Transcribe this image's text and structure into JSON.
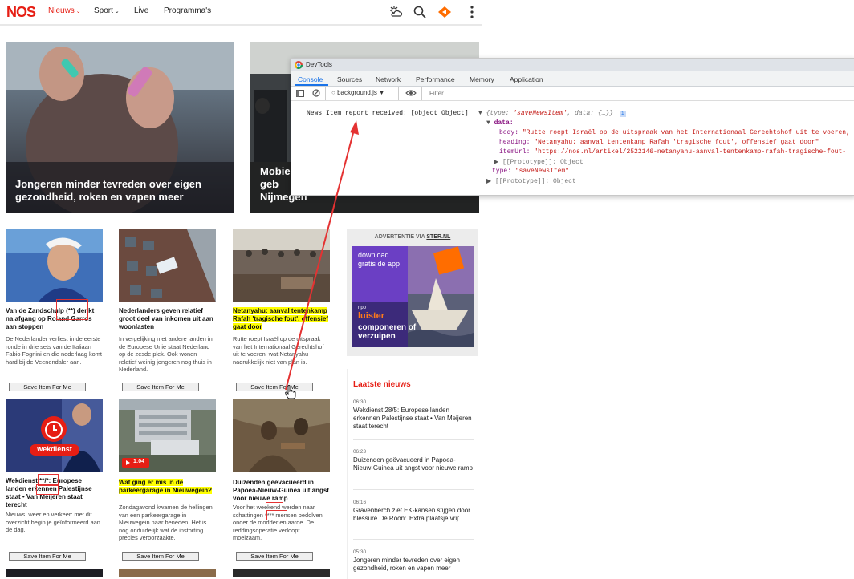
{
  "nav": {
    "logo": "NOS",
    "items": [
      {
        "label": "Nieuws",
        "caret": "⌄",
        "active": true
      },
      {
        "label": "Sport",
        "caret": "⌄",
        "active": false
      },
      {
        "label": "Live",
        "caret": "",
        "active": false
      },
      {
        "label": "Programma's",
        "caret": "",
        "active": false
      }
    ]
  },
  "hero": [
    {
      "caption": "Jongeren minder tevreden over eigen gezondheid, roken en vapen meer"
    },
    {
      "caption": "Mobie in geb Nijmegen"
    }
  ],
  "cards": [
    {
      "title": "Van de Zandschulp (**) denkt na afgang op Roland Garros aan stoppen",
      "body": "De Nederlander verliest in de eerste ronde in drie sets van de Italiaan Fabio Fognini en die nederlaag komt hard bij de Veenendaler aan.",
      "button": "Save Item For Me",
      "highlight": false
    },
    {
      "title": "Nederlanders geven relatief groot deel van inkomen uit aan woonlasten",
      "body": "In vergelijking met andere landen in de Europese Unie staat Nederland op de zesde plek. Ook wonen relatief weinig jongeren nog thuis in Nederland.",
      "button": "Save Item For Me",
      "highlight": false
    },
    {
      "title": "Netanyahu: aanval tentenkamp Rafah 'tragische fout', offensief gaat door",
      "body": "Rutte roept Israël op de uitspraak van het Internationaal Gerechtshof uit te voeren, wat Netanyahu nadrukkelijk niet van plan is.",
      "button": "Save Item For Me",
      "highlight": true
    },
    {
      "title": "Wekdienst **/*: Europese landen erkennen Palestijnse staat • Van Meijeren staat terecht",
      "body": "Nieuws, weer en verkeer: met dit overzicht begin je geïnformeerd aan de dag.",
      "button": "Save Item For Me",
      "highlight": false,
      "badge": "wekdienst"
    },
    {
      "title": "Wat ging er mis in de parkeergarage in Nieuwegein?",
      "body": "Zondagavond kwamen de hellingen van een parkeergarage in Nieuwegein naar beneden. Het is nog onduidelijk wat de instorting precies veroorzaakte.",
      "button": "Save Item For Me",
      "highlight": true,
      "video": "1:04"
    },
    {
      "title": "Duizenden geëvacueerd in Papoea-Nieuw-Guinea uit angst voor nieuwe ramp",
      "body": "Voor het weekend werden naar schattingen **** mensen bedolven onder de modder en aarde. De reddingsoperatie verloopt moeizaam.",
      "button": "Save Item For Me",
      "highlight": false
    }
  ],
  "ad": {
    "label": "ADVERTENTIE VIA",
    "label_link": "STER.NL",
    "left_text": "download gratis de app",
    "brand_small": "npo",
    "brand": "luister",
    "tagline": "componeren of verzuipen"
  },
  "latest": {
    "title": "Laatste nieuws",
    "items": [
      {
        "time": "06:30",
        "text": "Wekdienst 28/5: Europese landen erkennen Palestijnse staat • Van Meijeren staat terecht"
      },
      {
        "time": "06:23",
        "text": "Duizenden geëvacueerd in Papoea-Nieuw-Guinea uit angst voor nieuwe ramp"
      },
      {
        "time": "06:16",
        "text": "Gravenberch ziet EK-kansen stijgen door blessure De Roon: 'Extra plaatsje vrij'"
      },
      {
        "time": "05:30",
        "text": "Jongeren minder tevreden over eigen gezondheid, roken en vapen meer"
      }
    ]
  },
  "devtools": {
    "title": "DevTools",
    "tabs": [
      "Console",
      "Sources",
      "Network",
      "Performance",
      "Memory",
      "Application"
    ],
    "context": "background.js",
    "filter_placeholder": "Filter",
    "log_message": "News Item report received: [object Object]",
    "summary_open": "{type: ",
    "summary_type": "'saveNewsItem'",
    "summary_mid": ", data: {…}}",
    "data_key": "data:",
    "body_key": "body:",
    "body_val": "\"Rutte roept Israël op de uitspraak van het Internationaal Gerechtshof uit te voeren,",
    "heading_key": "heading:",
    "heading_val": "\"Netanyahu: aanval tentenkamp Rafah 'tragische fout', offensief gaat door\"",
    "url_key": "itemUrl:",
    "url_val": "\"https://nos.nl/artikel/2522146-netanyahu-aanval-tentenkamp-rafah-tragische-fout-",
    "proto_inner": "[[Prototype]]: Object",
    "type_key": "type:",
    "type_val": "\"saveNewsItem\"",
    "proto_outer": "[[Prototype]]: Object"
  },
  "colors": {
    "brand_red": "#e61e14",
    "highlight": "#ffff00",
    "annotation": "#e43232",
    "devtools_blue": "#1a73e8"
  }
}
